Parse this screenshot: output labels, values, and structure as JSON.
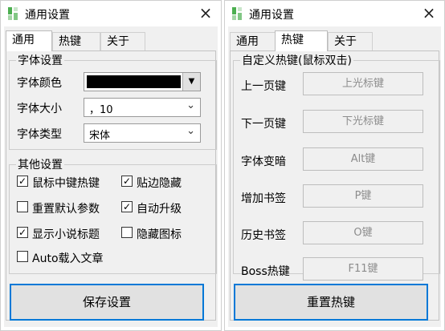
{
  "windows": {
    "general": {
      "title": "通用设置",
      "close": "×",
      "tabs": [
        "通用",
        "热键",
        "关于"
      ],
      "font_group": {
        "title": "字体设置",
        "color_label": "字体颜色",
        "color_value": "#000000",
        "size_label": "字体大小",
        "size_value": "，10",
        "type_label": "字体类型",
        "type_value": "宋体"
      },
      "other_group": {
        "title": "其他设置",
        "options": [
          {
            "label": "鼠标中键热键",
            "checked": true,
            "mark": "✓"
          },
          {
            "label": "贴边隐藏",
            "checked": true,
            "mark": "✓"
          },
          {
            "label": "重置默认参数",
            "checked": false,
            "mark": ""
          },
          {
            "label": "自动升级",
            "checked": true,
            "mark": "✓"
          },
          {
            "label": "显示小说标题",
            "checked": true,
            "mark": "✓"
          },
          {
            "label": "隐藏图标",
            "checked": false,
            "mark": ""
          },
          {
            "label": "Auto载入文章",
            "checked": false,
            "mark": ""
          }
        ]
      },
      "save_button": "保存设置"
    },
    "hotkey": {
      "title": "通用设置",
      "close": "×",
      "tabs": [
        "通用",
        "热键",
        "关于"
      ],
      "group_title": "自定义热键(鼠标双击)",
      "rows": [
        {
          "label": "上一页键",
          "value": "上光标键"
        },
        {
          "label": "下一页键",
          "value": "下光标键"
        },
        {
          "label": "字体变暗",
          "value": "Alt键"
        },
        {
          "label": "增加书签",
          "value": "P键"
        },
        {
          "label": "历史书签",
          "value": "O键"
        },
        {
          "label": "Boss热键",
          "value": "F11键"
        }
      ],
      "reset_button": "重置热键"
    }
  },
  "colors": {
    "accent": "#0078d7",
    "panel_bg": "#f0f0f0"
  },
  "icons": [
    "app-icon",
    "close-icon",
    "chevron-down-icon",
    "check-icon"
  ]
}
